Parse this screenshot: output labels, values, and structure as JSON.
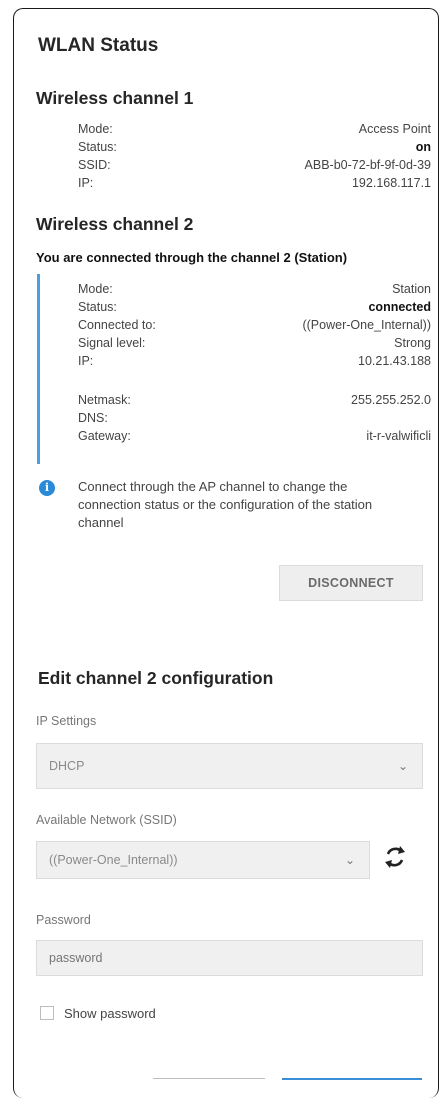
{
  "title": "WLAN Status",
  "channel1": {
    "heading": "Wireless channel 1",
    "rows": [
      {
        "label": "Mode:",
        "value": "Access Point"
      },
      {
        "label": "Status:",
        "value": "on"
      },
      {
        "label": "SSID:",
        "value": "ABB-b0-72-bf-9f-0d-39"
      },
      {
        "label": "IP:",
        "value": "192.168.117.1"
      }
    ]
  },
  "channel2": {
    "heading": "Wireless channel 2",
    "notice": "You are connected through the channel 2 (Station)",
    "rows": [
      {
        "label": "Mode:",
        "value": "Station"
      },
      {
        "label": "Status:",
        "value": "connected"
      },
      {
        "label": "Connected to:",
        "value": "((Power-One_Internal))"
      },
      {
        "label": "Signal level:",
        "value": "Strong"
      },
      {
        "label": "IP:",
        "value": "10.21.43.188"
      },
      {
        "label": "Netmask:",
        "value": "255.255.252.0"
      },
      {
        "label": "DNS:",
        "value": ""
      },
      {
        "label": "Gateway:",
        "value": "it-r-valwificli"
      }
    ]
  },
  "info": {
    "icon": "info-icon",
    "text": "Connect through the AP channel to change the connection status or the configuration of the station channel"
  },
  "disconnect_label": "DISCONNECT",
  "edit": {
    "heading": "Edit channel 2 configuration",
    "ip_settings_label": "IP Settings",
    "ip_settings_value": "DHCP",
    "ssid_label": "Available Network (SSID)",
    "ssid_value": "((Power-One_Internal))",
    "password_label": "Password",
    "password_placeholder": "password",
    "show_password_label": "Show password"
  },
  "colors": {
    "accent": "#4a9fe0",
    "info": "#2b8ad8"
  }
}
